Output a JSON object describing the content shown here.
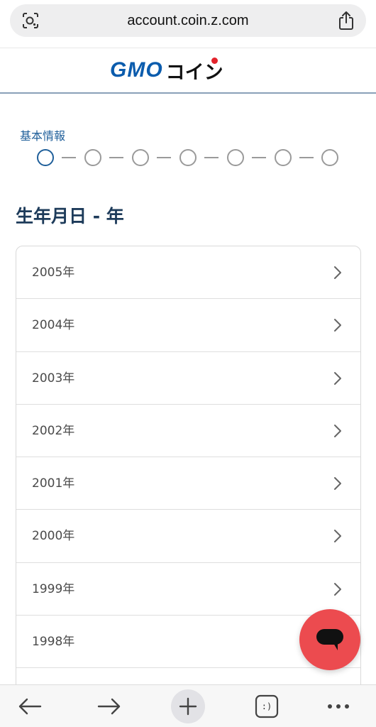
{
  "browser": {
    "url": "account.coin.z.com",
    "lens_icon": "lens-icon",
    "share_icon": "share-icon",
    "toolbar": {
      "back_icon": "arrow-left-icon",
      "forward_icon": "arrow-right-icon",
      "new_tab_icon": "plus-icon",
      "tabs_label": ":)",
      "more_icon": "more-dots-icon"
    }
  },
  "header": {
    "logo_latin": "GMO",
    "logo_kana": "コイン",
    "brand_blue": "#0b5cad",
    "brand_red": "#e3232c"
  },
  "stepper": {
    "label": "基本情報",
    "total_steps": 7,
    "current_step": 1
  },
  "main": {
    "title": "生年月日 - 年",
    "years": [
      {
        "label": "2005年"
      },
      {
        "label": "2004年"
      },
      {
        "label": "2003年"
      },
      {
        "label": "2002年"
      },
      {
        "label": "2001年"
      },
      {
        "label": "2000年"
      },
      {
        "label": "1999年"
      },
      {
        "label": "1998年"
      }
    ]
  },
  "chat": {
    "icon": "chat-bubble-icon",
    "color": "#ec4b4f"
  }
}
